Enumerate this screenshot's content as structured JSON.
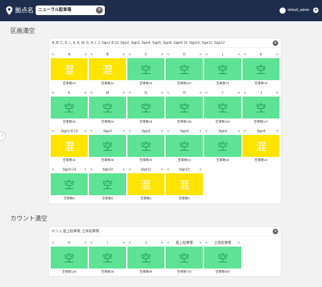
{
  "header": {
    "location_label": "拠点名",
    "location_value": "ニューラル駐車場",
    "user_name": "default_admin",
    "icons": {
      "pin": "map-pin-icon",
      "clear": "close-icon",
      "user": "account-icon",
      "menu": "chevron-down-icon"
    },
    "colors": {
      "bg": "#1f2d4d"
    }
  },
  "sections": [
    {
      "title": "区画満空",
      "filter_text": "A, B, C, D, L, E, K, M, G, H, I, J, Sign1-8-13, Sign2, Sign3, Sign4, Sign5, Sign6, Sign9-14, Sign10, Sign11, Sign12",
      "cards": [
        {
          "name": "A",
          "status": "混",
          "count": "空車数24"
        },
        {
          "name": "B",
          "status": "混",
          "count": "空車数11"
        },
        {
          "name": "C",
          "status": "空",
          "count": "空車数40"
        },
        {
          "name": "D",
          "status": "空",
          "count": "空車数127"
        },
        {
          "name": "L",
          "status": "空",
          "count": "空車数73"
        },
        {
          "name": "E",
          "status": "空",
          "count": "空車数75"
        },
        {
          "name": "K",
          "status": "空",
          "count": "空車数36"
        },
        {
          "name": "M",
          "status": "空",
          "count": "空車数84"
        },
        {
          "name": "G",
          "status": "空",
          "count": "空車数45"
        },
        {
          "name": "H",
          "status": "空",
          "count": "空車数135"
        },
        {
          "name": "I",
          "status": "空",
          "count": "空車数160"
        },
        {
          "name": "J",
          "status": "空",
          "count": "空車数127"
        },
        {
          "name": "Sign1-8-13",
          "status": "混",
          "count": "空車数16"
        },
        {
          "name": "Sign2",
          "status": "空",
          "count": "空車数39"
        },
        {
          "name": "Sign3",
          "status": "空",
          "count": "空車数32"
        },
        {
          "name": "Sign4",
          "status": "空",
          "count": "空車数31"
        },
        {
          "name": "Sign5",
          "status": "空",
          "count": "空車数25"
        },
        {
          "name": "Sign6",
          "status": "混",
          "count": "空車数10"
        },
        {
          "name": "Sign9-14",
          "status": "空",
          "count": "空車数9"
        },
        {
          "name": "Sign10",
          "status": "空",
          "count": "空車数6"
        },
        {
          "name": "Sign11",
          "status": "混",
          "count": "空車数2"
        },
        {
          "name": "Sign12",
          "status": "混",
          "count": "空車数0"
        }
      ]
    },
    {
      "title": "カウント満空",
      "filter_text": "H, I, J, 屋上駐車場, 立体駐車場",
      "cards": [
        {
          "name": "H",
          "status": "空",
          "count": "空車数135"
        },
        {
          "name": "I",
          "status": "空",
          "count": "空車数48"
        },
        {
          "name": "J",
          "status": "空",
          "count": "空車数99"
        },
        {
          "name": "屋上駐車場",
          "status": "空",
          "count": "空車数723"
        },
        {
          "name": "立体駐車場",
          "status": "空",
          "count": "空車数309"
        }
      ]
    }
  ],
  "nav": {
    "prev": "<",
    "next": ">",
    "side_toggle": "‹",
    "clear": "✕"
  },
  "status_colors": {
    "空": "#5de393",
    "混": "#ffe400"
  }
}
